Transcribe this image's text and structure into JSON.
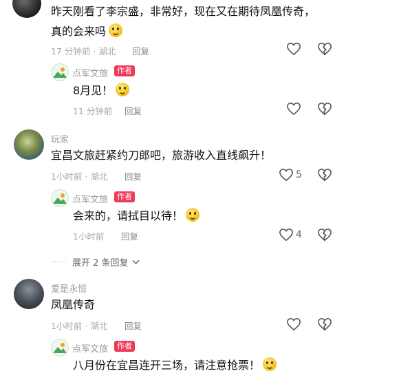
{
  "comments": [
    {
      "text_line1": "昨天刚看了李宗盛，非常好，现在又在期待凤凰传奇，",
      "text_line2": "真的会来吗",
      "time": "17 分钟前 · 湖北",
      "reply": "回复",
      "author_reply": {
        "name": "点军文旅",
        "tag": "作者",
        "text": "8月见！",
        "time": "11 分钟前",
        "reply": "回复"
      }
    },
    {
      "username": "玩家",
      "text": "宜昌文旅赶紧约刀郎吧，旅游收入直线飙升！",
      "time": "1小时前 · 湖北",
      "reply": "回复",
      "likes": "5",
      "author_reply": {
        "name": "点军文旅",
        "tag": "作者",
        "text": "会来的，请拭目以待！",
        "time": "1小时前",
        "reply": "回复",
        "likes": "4"
      },
      "expand": "展开 2 条回复"
    },
    {
      "username": "爱是永恒",
      "text": "凤凰传奇",
      "time": "1小时前 · 湖北",
      "reply": "回复",
      "author_reply": {
        "name": "点军文旅",
        "tag": "作者",
        "text": "八月份在宜昌连开三场，请注意抢票！"
      }
    }
  ],
  "icons": {
    "like": "heart-icon",
    "dislike": "broken-heart-icon",
    "expand": "chevron-down-icon"
  },
  "colors": {
    "author_tag": "#f03a5a",
    "meta_text": "#a7a7a7"
  }
}
